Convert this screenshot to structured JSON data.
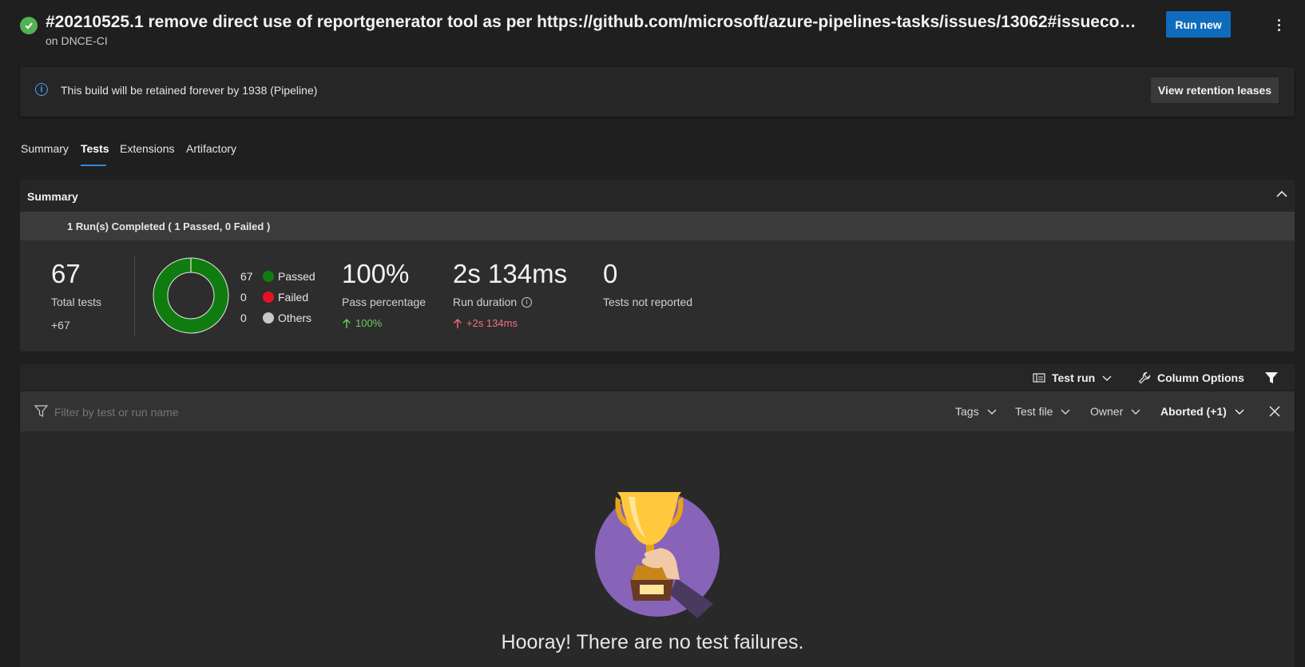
{
  "header": {
    "title": "#20210525.1 remove direct use of reportgenerator tool as per https://github.com/microsoft/azure-pipelines-tasks/issues/13062#issuecomment-8057...",
    "subtitle": "on DNCE-CI",
    "run_new_label": "Run new",
    "status_icon": "check-circle-icon"
  },
  "banner": {
    "text": "This build will be retained forever by 1938 (Pipeline)",
    "button_label": "View retention leases"
  },
  "tabs": [
    {
      "label": "Summary"
    },
    {
      "label": "Tests",
      "active": true
    },
    {
      "label": "Extensions"
    },
    {
      "label": "Artifactory"
    }
  ],
  "summary": {
    "title": "Summary",
    "runs_completed": "1 Run(s) Completed ( 1 Passed, 0 Failed )",
    "total_tests": {
      "value": "67",
      "label": "Total tests",
      "delta": "+67"
    },
    "legend": [
      {
        "count": "67",
        "label": "Passed",
        "color": "#107c10"
      },
      {
        "count": "0",
        "label": "Failed",
        "color": "#e81123"
      },
      {
        "count": "0",
        "label": "Others",
        "color": "#c8c8c8"
      }
    ],
    "pass_percentage": {
      "value": "100%",
      "label": "Pass percentage",
      "delta": "100%"
    },
    "run_duration": {
      "value": "2s 134ms",
      "label": "Run duration",
      "delta": "+2s 134ms"
    },
    "not_reported": {
      "value": "0",
      "label": "Tests not reported"
    }
  },
  "toolbar": {
    "test_run_label": "Test run",
    "column_options_label": "Column Options"
  },
  "filter": {
    "placeholder": "Filter by test or run name",
    "tags_label": "Tags",
    "test_file_label": "Test file",
    "owner_label": "Owner",
    "outcome_label": "Aborted (+1)"
  },
  "empty_state": {
    "message": "Hooray! There are no test failures."
  },
  "colors": {
    "accent": "#0f6cbd",
    "passed": "#107c10",
    "failed": "#e81123",
    "delta_up_good": "#6ccb5f",
    "delta_up_bad": "#f1707b"
  }
}
